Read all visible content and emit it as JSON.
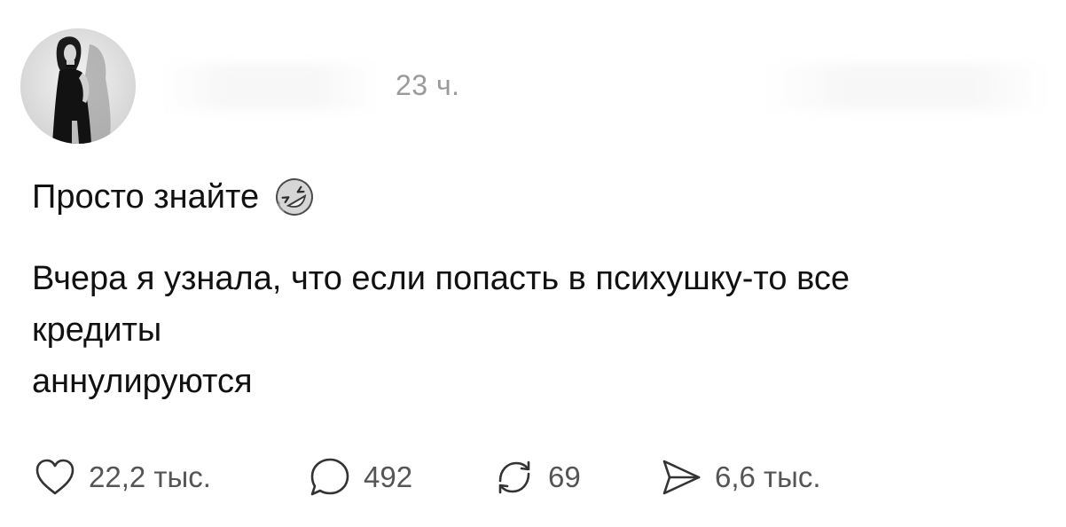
{
  "post": {
    "timestamp": "23 ч.",
    "title": "Просто знайте",
    "title_emoji_icon": "rolling-on-floor-laughing-icon",
    "body_lines": [
      "Вчера я узнала, что если попасть в психушку-то все",
      "кредиты",
      "аннулируются"
    ]
  },
  "actions": {
    "likes": {
      "icon": "heart-icon",
      "count": "22,2 тыс."
    },
    "comments": {
      "icon": "comment-bubble-icon",
      "count": "492"
    },
    "reposts": {
      "icon": "repost-icon",
      "count": "69"
    },
    "shares": {
      "icon": "send-icon",
      "count": "6,6 тыс."
    }
  }
}
